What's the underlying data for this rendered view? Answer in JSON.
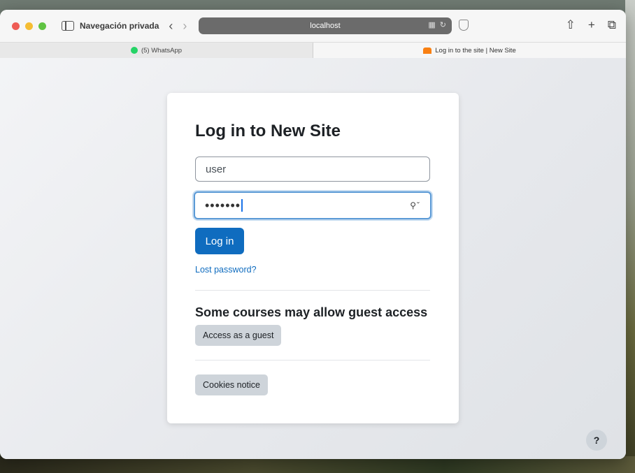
{
  "browser": {
    "private_label": "Navegación privada",
    "address": "localhost",
    "tabs": [
      {
        "label": "(5) WhatsApp",
        "active": false
      },
      {
        "label": "Log in to the site | New Site",
        "active": true
      }
    ]
  },
  "login": {
    "title": "Log in to New Site",
    "username_value": "user",
    "password_mask": "•••••••",
    "login_button": "Log in",
    "lost_password": "Lost password?"
  },
  "guest": {
    "title": "Some courses may allow guest access",
    "button": "Access as a guest"
  },
  "cookies_button": "Cookies notice",
  "help_button": "?",
  "colors": {
    "primary": "#0f6cbf",
    "secondary_button": "#ced4da",
    "focus_ring": "#5b9ad6"
  }
}
